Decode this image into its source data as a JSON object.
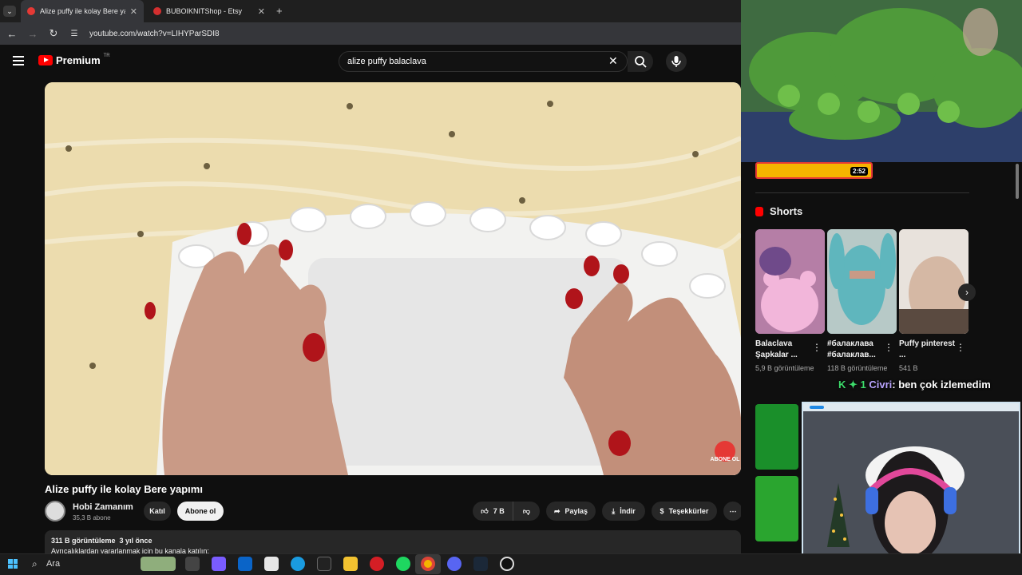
{
  "tabs": [
    {
      "label": "Alize puffy ile kolay Bere yapımı",
      "active": true
    },
    {
      "label": "BUBOIKNITShop - Etsy",
      "active": false
    }
  ],
  "address": {
    "url": "youtube.com/watch?v=LIHYParSDI8"
  },
  "youtube": {
    "logo_text": "Premium",
    "region": "TR",
    "search_value": "alize puffy balaclava"
  },
  "video": {
    "title": "Alize puffy ile kolay Bere yapımı",
    "watermark": "ABONE OL",
    "channel": "Hobi Zamanım",
    "subscribers": "35,3 B abone",
    "join_label": "Katıl",
    "subscribe_label": "Abone ol",
    "likes": "7 B",
    "share_label": "Paylaş",
    "download_label": "İndir",
    "thanks_label": "Teşekkürler",
    "views": "311 B görüntüleme",
    "age": "3 yıl önce",
    "desc_line": "Ayrıcalıklardan yararlanmak için bu kanala katılın:"
  },
  "sidebar": {
    "prev_duration": "2:52",
    "shorts_heading": "Shorts",
    "shorts": [
      {
        "title": "Balaclava Şapkalar ...",
        "views": "5,9 B görüntüleme"
      },
      {
        "title": "#балаклава #балаклав...",
        "views": "118 B görüntüleme"
      },
      {
        "title": "Puffy pinterest ...",
        "views": "541 B"
      }
    ]
  },
  "stream_overlay": {
    "user": "Civri",
    "message": ": ben çok izlemedim",
    "badge": "K ✦ 1"
  },
  "taskbar": {
    "search_label": "Ara"
  }
}
